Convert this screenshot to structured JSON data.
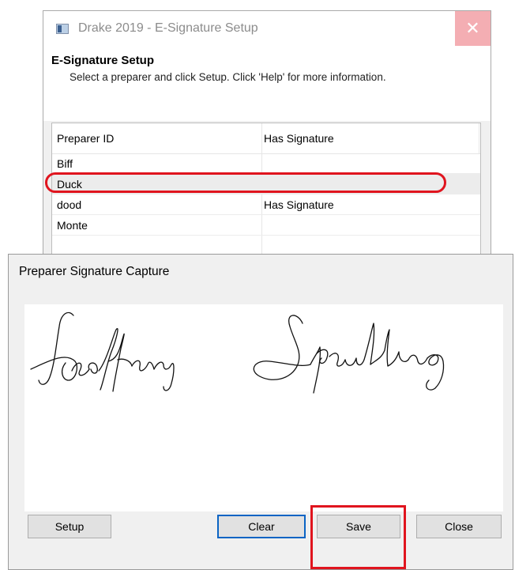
{
  "setup_window": {
    "title": "Drake 2019 - E-Signature Setup",
    "close_glyph": "✕",
    "heading": "E-Signature Setup",
    "description": "Select a preparer and click Setup. Click 'Help' for more information.",
    "columns": [
      "Preparer ID",
      "Has Signature"
    ],
    "rows": [
      {
        "id": "Biff",
        "signature": ""
      },
      {
        "id": "Duck",
        "signature": ""
      },
      {
        "id": "dood",
        "signature": "Has Signature"
      },
      {
        "id": "Monte",
        "signature": ""
      }
    ],
    "selected_row": "Duck"
  },
  "capture_dialog": {
    "title": "Preparer Signature Capture",
    "buttons": {
      "setup": "Setup",
      "clear": "Clear",
      "save": "Save",
      "close": "Close"
    }
  },
  "annotations": {
    "highlight_color": "#e0141e"
  },
  "icons": [
    "app-window-icon",
    "close-icon"
  ]
}
